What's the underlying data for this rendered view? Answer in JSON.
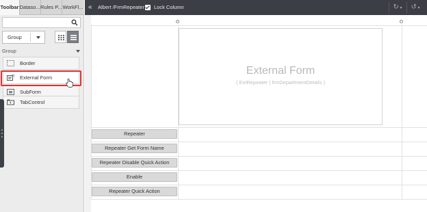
{
  "left_panel": {
    "tabs": [
      {
        "label": "Toolbar",
        "active": true
      },
      {
        "label": "Dataso..."
      },
      {
        "label": "Rules P..."
      },
      {
        "label": "WorkFl..."
      }
    ],
    "search": {
      "value": "",
      "placeholder": ""
    },
    "group_select": {
      "selected": "Group"
    },
    "group_header": "Group",
    "items": [
      {
        "label": "Border",
        "icon": "border-icon"
      },
      {
        "label": "External Form",
        "icon": "external-form-icon"
      },
      {
        "label": "SubForm",
        "icon": "subform-icon"
      },
      {
        "label": "TabControl",
        "icon": "tabcontrol-icon"
      }
    ]
  },
  "top_bar": {
    "collapse_glyph": "«",
    "breadcrumb": "Albert /FrmRepeater",
    "lock_column_label": "Lock Column",
    "lock_column_checked": true,
    "redo_glyph": "↻",
    "undo_glyph": "↺"
  },
  "canvas": {
    "external_form": {
      "title": "External Form",
      "subtitle": "( ExtRepeater | frmDepartmentDetails )"
    },
    "buttons": [
      {
        "label": "Repeater"
      },
      {
        "label": "Repeater Get Form Name"
      },
      {
        "label": "Repeater Disable Quick Action"
      },
      {
        "label": "Enable"
      },
      {
        "label": "Repeater Quick Action"
      }
    ]
  },
  "colors": {
    "topbar_bg": "#3b3f45",
    "highlight": "#e03232",
    "panel_bg": "#ececec"
  }
}
